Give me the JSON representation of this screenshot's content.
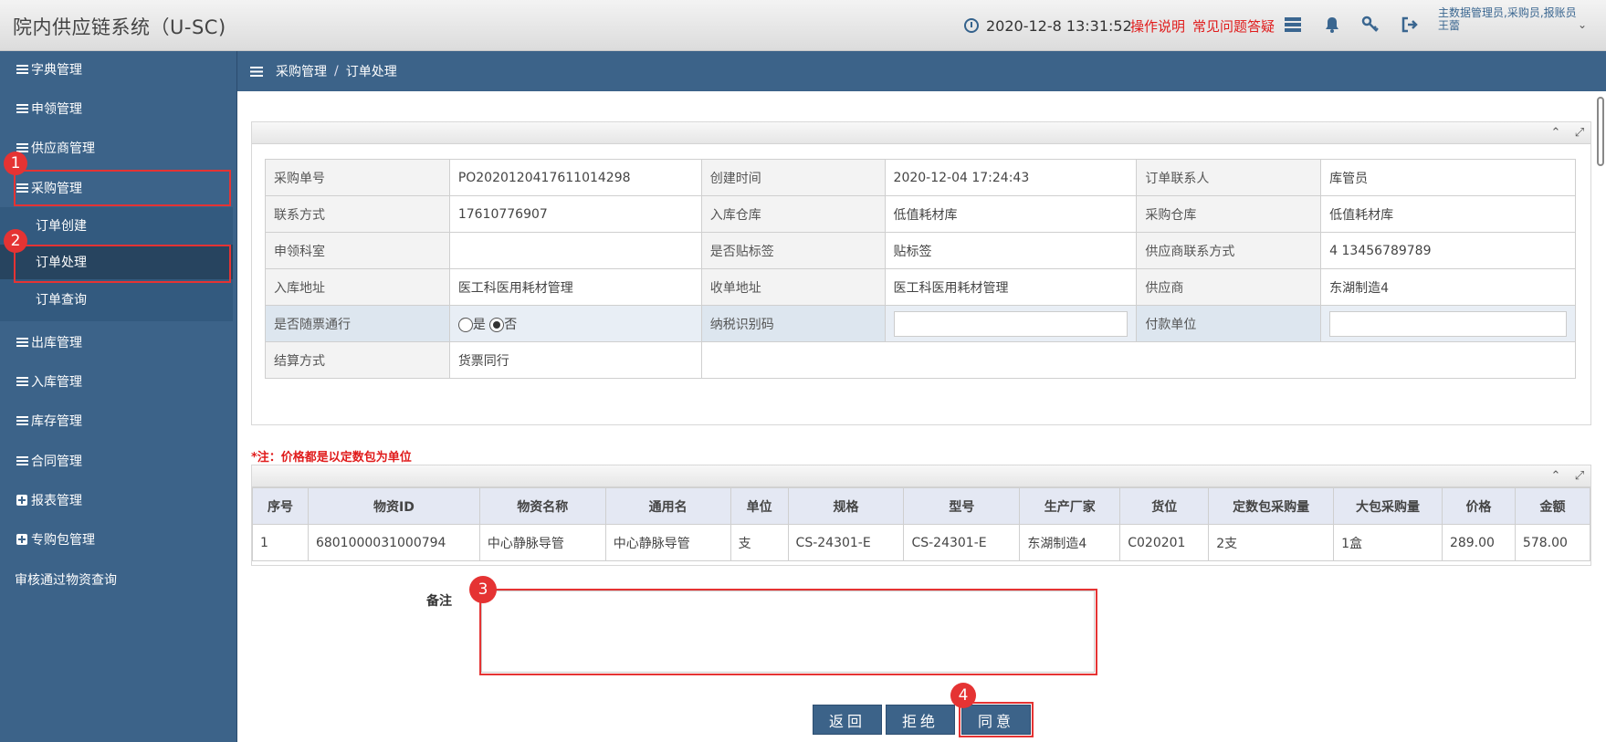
{
  "header": {
    "title": "院内供应链系统（U-SC)",
    "datetime": "2020-12-8  13:31:52",
    "help_link": "操作说明",
    "faq_link": "常见问题答疑",
    "user_roles": "主数据管理员,采购员,报账员",
    "user_name": "王蕾"
  },
  "sidebar": {
    "items": [
      {
        "label": "字典管理",
        "icon": "list-icon"
      },
      {
        "label": "申领管理",
        "icon": "list-icon"
      },
      {
        "label": "供应商管理",
        "icon": "list-icon"
      },
      {
        "label": "采购管理",
        "icon": "list-icon"
      },
      {
        "label": "出库管理",
        "icon": "list-icon"
      },
      {
        "label": "入库管理",
        "icon": "list-icon"
      },
      {
        "label": "库存管理",
        "icon": "list-icon"
      },
      {
        "label": "合同管理",
        "icon": "list-icon"
      },
      {
        "label": "报表管理",
        "icon": "plus-icon"
      },
      {
        "label": "专购包管理",
        "icon": "plus-icon"
      },
      {
        "label": "审核通过物资查询",
        "icon": ""
      }
    ],
    "sub_items": [
      "订单创建",
      "订单处理",
      "订单查询"
    ]
  },
  "breadcrumb": {
    "parent": "采购管理",
    "sep": "/",
    "current": "订单处理"
  },
  "order": {
    "order_no_label": "采购单号",
    "order_no": "PO2020120417611014298",
    "created_label": "创建时间",
    "created": "2020-12-04 17:24:43",
    "contact_label": "订单联系人",
    "contact": "库管员",
    "phone_label": "联系方式",
    "phone": "17610776907",
    "in_wh_label": "入库仓库",
    "in_wh": "低值耗材库",
    "purchase_wh_label": "采购仓库",
    "purchase_wh": "低值耗材库",
    "dept_label": "申领科室",
    "dept": "",
    "tag_label": "是否贴标签",
    "tag": "贴标签",
    "supplier_contact_label": "供应商联系方式",
    "supplier_contact": "4 13456789789",
    "in_addr_label": "入库地址",
    "in_addr": "医工科医用耗材管理",
    "recv_addr_label": "收单地址",
    "recv_addr": "医工科医用耗材管理",
    "supplier_label": "供应商",
    "supplier": "东湖制造4",
    "invoice_label": "是否随票通行",
    "opt_yes": "是",
    "opt_no": "否",
    "tax_label": "纳税识别码",
    "payer_label": "付款单位",
    "settle_label": "结算方式",
    "settle": "货票同行"
  },
  "note": "*注：价格都是以定数包为单位",
  "items_table": {
    "headers": [
      "序号",
      "物资ID",
      "物资名称",
      "通用名",
      "单位",
      "规格",
      "型号",
      "生产厂家",
      "货位",
      "定数包采购量",
      "大包采购量",
      "价格",
      "金额"
    ],
    "rows": [
      [
        "1",
        "6801000031000794",
        "中心静脉导管",
        "中心静脉导管",
        "支",
        "CS-24301-E",
        "CS-24301-E",
        "东湖制造4",
        "C020201",
        "2支",
        "1盒",
        "289.00",
        "578.00"
      ]
    ]
  },
  "remark_label": "备注",
  "buttons": {
    "back": "返回",
    "reject": "拒绝",
    "agree": "同意"
  },
  "markers": [
    "1",
    "2",
    "3",
    "4"
  ],
  "colors": {
    "sidebar": "#3c6389",
    "highlight": "#e53333",
    "note": "#e01b1b"
  }
}
